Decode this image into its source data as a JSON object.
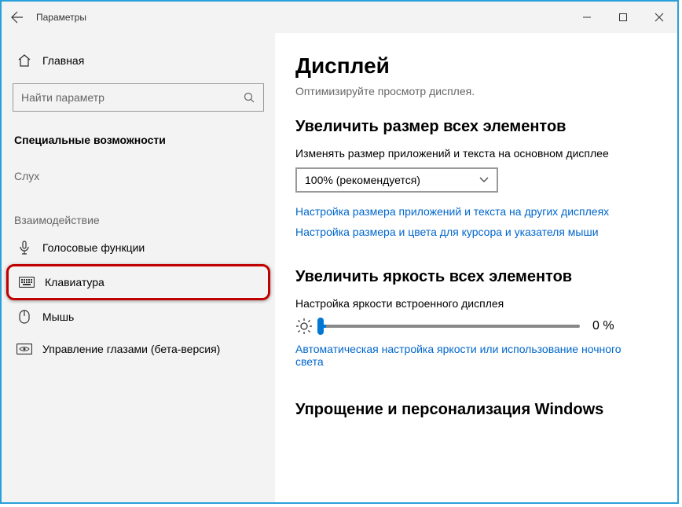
{
  "titlebar": {
    "title": "Параметры"
  },
  "sidebar": {
    "home": "Главная",
    "search_placeholder": "Найти параметр",
    "section_main": "Специальные возможности",
    "section_hearing": "Слух",
    "section_interaction": "Взаимодействие",
    "items": {
      "speech": "Голосовые функции",
      "keyboard": "Клавиатура",
      "mouse": "Мышь",
      "eye": "Управление глазами (бета-версия)"
    }
  },
  "content": {
    "h1": "Дисплей",
    "subtitle": "Оптимизируйте просмотр дисплея.",
    "section_scale": {
      "heading": "Увеличить размер всех элементов",
      "line": "Изменять размер приложений и текста на основном дисплее",
      "dropdown_value": "100% (рекомендуется)",
      "link1": "Настройка размера приложений и текста на других дисплеях",
      "link2": "Настройка размера и цвета для курсора и указателя мыши"
    },
    "section_bright": {
      "heading": "Увеличить яркость всех элементов",
      "line": "Настройка яркости встроенного дисплея",
      "percent": "0 %",
      "link": "Автоматическая настройка яркости или использование ночного света"
    },
    "section_simplify": {
      "heading": "Упрощение и персонализация Windows"
    }
  }
}
